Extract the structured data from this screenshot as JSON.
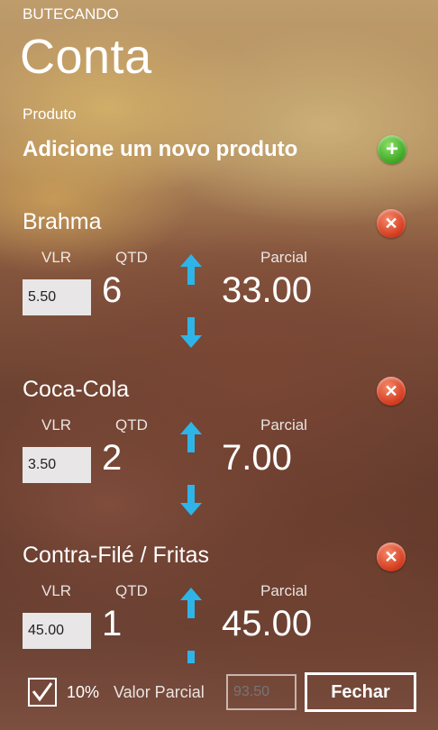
{
  "app": {
    "name": "BUTECANDO"
  },
  "page": {
    "title": "Conta"
  },
  "produto": {
    "label": "Produto",
    "add_text": "Adicione um novo produto"
  },
  "labels": {
    "vlr": "VLR",
    "qtd": "QTD",
    "parcial": "Parcial"
  },
  "items": [
    {
      "name": "Brahma",
      "vlr": "5.50",
      "qtd": "6",
      "parcial": "33.00"
    },
    {
      "name": "Coca-Cola",
      "vlr": "3.50",
      "qtd": "2",
      "parcial": "7.00"
    },
    {
      "name": "Contra-Filé / Fritas",
      "vlr": "45.00",
      "qtd": "1",
      "parcial": "45.00"
    }
  ],
  "footer": {
    "checkbox_checked": true,
    "percent_label": "10%",
    "valor_parcial_label": "Valor Parcial",
    "valor_parcial_placeholder": "93.50",
    "close_button": "Fechar"
  },
  "colors": {
    "add": "#3aa521",
    "delete": "#d2381c",
    "arrow": "#2fb4e8"
  },
  "icons": {
    "add": "plus-circle-icon",
    "delete": "x-circle-icon",
    "up": "arrow-up-icon",
    "down": "arrow-down-icon",
    "check": "checkmark-icon"
  }
}
